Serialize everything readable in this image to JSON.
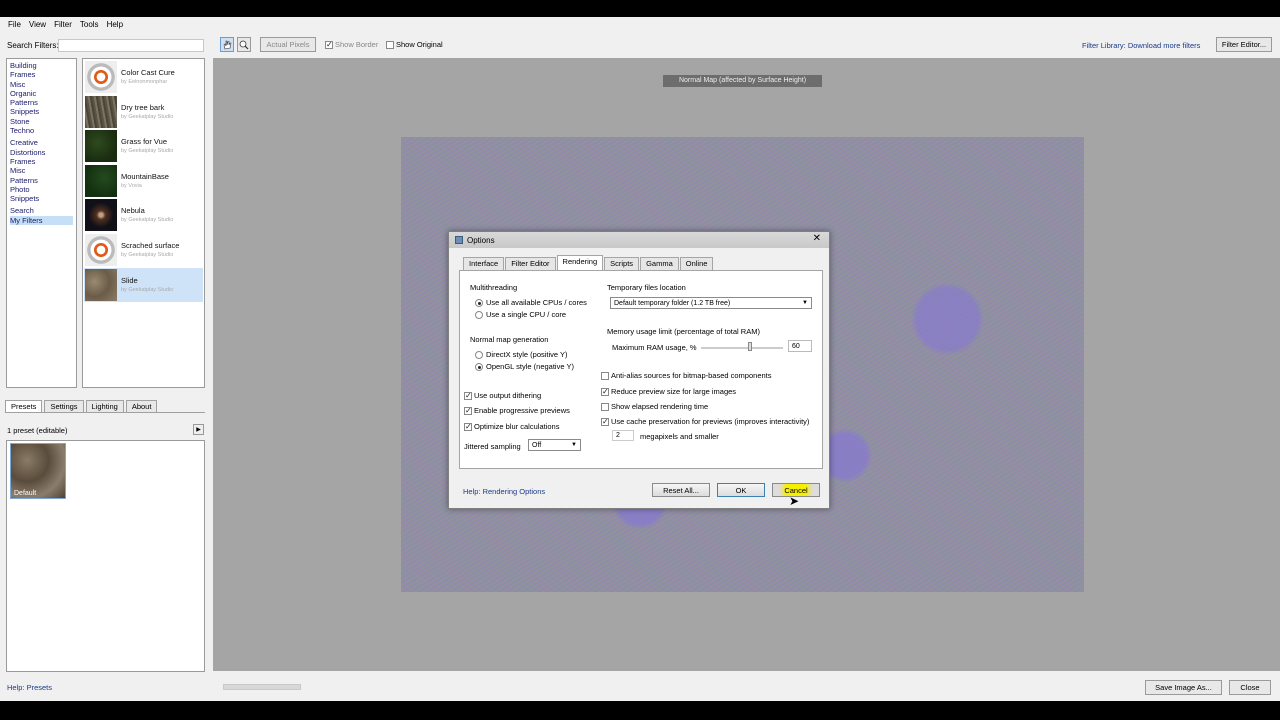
{
  "menu": [
    "File",
    "View",
    "Filter",
    "Tools",
    "Help"
  ],
  "search": {
    "label": "Search Filters:",
    "value": ""
  },
  "categories": {
    "group1": [
      "Building",
      "Frames",
      "Misc",
      "Organic",
      "Patterns",
      "Snippets",
      "Stone",
      "Techno"
    ],
    "group2": [
      "Creative",
      "Distortions",
      "Frames",
      "Misc",
      "Patterns",
      "Photo",
      "Snippets"
    ],
    "group3": [
      "Search",
      "My Filters"
    ]
  },
  "filters": [
    {
      "name": "Color Cast Cure",
      "by": "by Eelnonmonphar"
    },
    {
      "name": "Dry tree bark",
      "by": "by Geekatplay Studio"
    },
    {
      "name": "Grass for Vue",
      "by": "by Geekatplay Studio"
    },
    {
      "name": "MountainBase",
      "by": "by Vovia"
    },
    {
      "name": "Nebula",
      "by": "by Geekatplay Studio"
    },
    {
      "name": "Scrached surface",
      "by": "by Geekatplay Studio"
    },
    {
      "name": "Slide",
      "by": "by Geekatplay Studio"
    }
  ],
  "left_tabs": [
    "Presets",
    "Settings",
    "Lighting",
    "About"
  ],
  "presets": {
    "count_label": "1 preset (editable)",
    "thumb_label": "Default"
  },
  "help_presets": "Help: Presets",
  "toolbar": {
    "actual_pixels": "Actual Pixels",
    "show_border": "Show Border",
    "show_original": "Show Original",
    "filter_library": "Filter Library: Download more filters",
    "filter_editor": "Filter Editor..."
  },
  "preview": {
    "caption": "Normal Map (affected by Surface Height)"
  },
  "bottom": {
    "save_image": "Save Image As...",
    "close": "Close"
  },
  "dialog": {
    "title": "Options",
    "tabs": [
      "Interface",
      "Filter Editor",
      "Rendering",
      "Scripts",
      "Gamma",
      "Online"
    ],
    "multithreading": {
      "heading": "Multithreading",
      "opt1": "Use all available CPUs / cores",
      "opt2": "Use a single CPU / core"
    },
    "normal_map": {
      "heading": "Normal map generation",
      "opt1": "DirectX style (positive Y)",
      "opt2": "OpenGL style (negative Y)"
    },
    "checks_left": {
      "dithering": "Use output dithering",
      "progressive": "Enable progressive previews",
      "blur": "Optimize blur calculations"
    },
    "jittered": {
      "label": "Jittered sampling",
      "value": "Off"
    },
    "temp_files": {
      "heading": "Temporary files location",
      "value": "Default temporary folder (1.2 TB free)"
    },
    "memory": {
      "heading": "Memory usage limit (percentage of total RAM)",
      "label": "Maximum RAM usage, %",
      "value": "60"
    },
    "checks_right": {
      "antialias": "Anti-alias sources for bitmap-based components",
      "reduce": "Reduce preview size for large images",
      "elapsed": "Show elapsed rendering time",
      "cache": "Use cache preservation for previews (improves interactivity)"
    },
    "megapixels": {
      "value": "2",
      "label": "megapixels and smaller"
    },
    "help": "Help: Rendering Options",
    "buttons": {
      "reset": "Reset All...",
      "ok": "OK",
      "cancel": "Cancel"
    }
  }
}
